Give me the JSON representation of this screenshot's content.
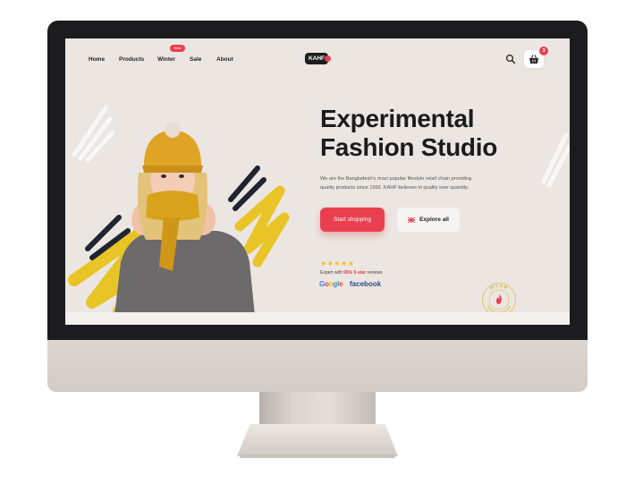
{
  "nav": {
    "links": [
      "Home",
      "Products",
      "Winter",
      "Sale",
      "About"
    ],
    "badge": "New"
  },
  "brand": {
    "logo": "KAHF"
  },
  "header": {
    "icons": [
      "search-icon",
      "basket-icon"
    ],
    "cart_count": "3"
  },
  "hero": {
    "title_line1": "Experimental",
    "title_line2": "Fashion Studio",
    "description_line1": "We are the Bangladesh's most popular lifestyle retail chain providing",
    "description_line2": "quality products since 1992. KAHF believes in quality over quantity.",
    "primary_button": "Start shopping",
    "secondary_button": "Explore all"
  },
  "rating": {
    "stars": "★★★★★",
    "text_prefix": "Expert with ",
    "highlight": "95% 5-star",
    "text_suffix": " reviews",
    "partners": [
      "Google",
      "facebook"
    ]
  },
  "stamp": {
    "top_text": "WEAR",
    "bottom_text": "WHAT MATTERS"
  },
  "colors": {
    "accent": "#e8404f",
    "screen_bg": "#ebe6e2",
    "bezel": "#1c1c1e",
    "mustard": "#d9a21d",
    "star": "#f1c21b"
  }
}
